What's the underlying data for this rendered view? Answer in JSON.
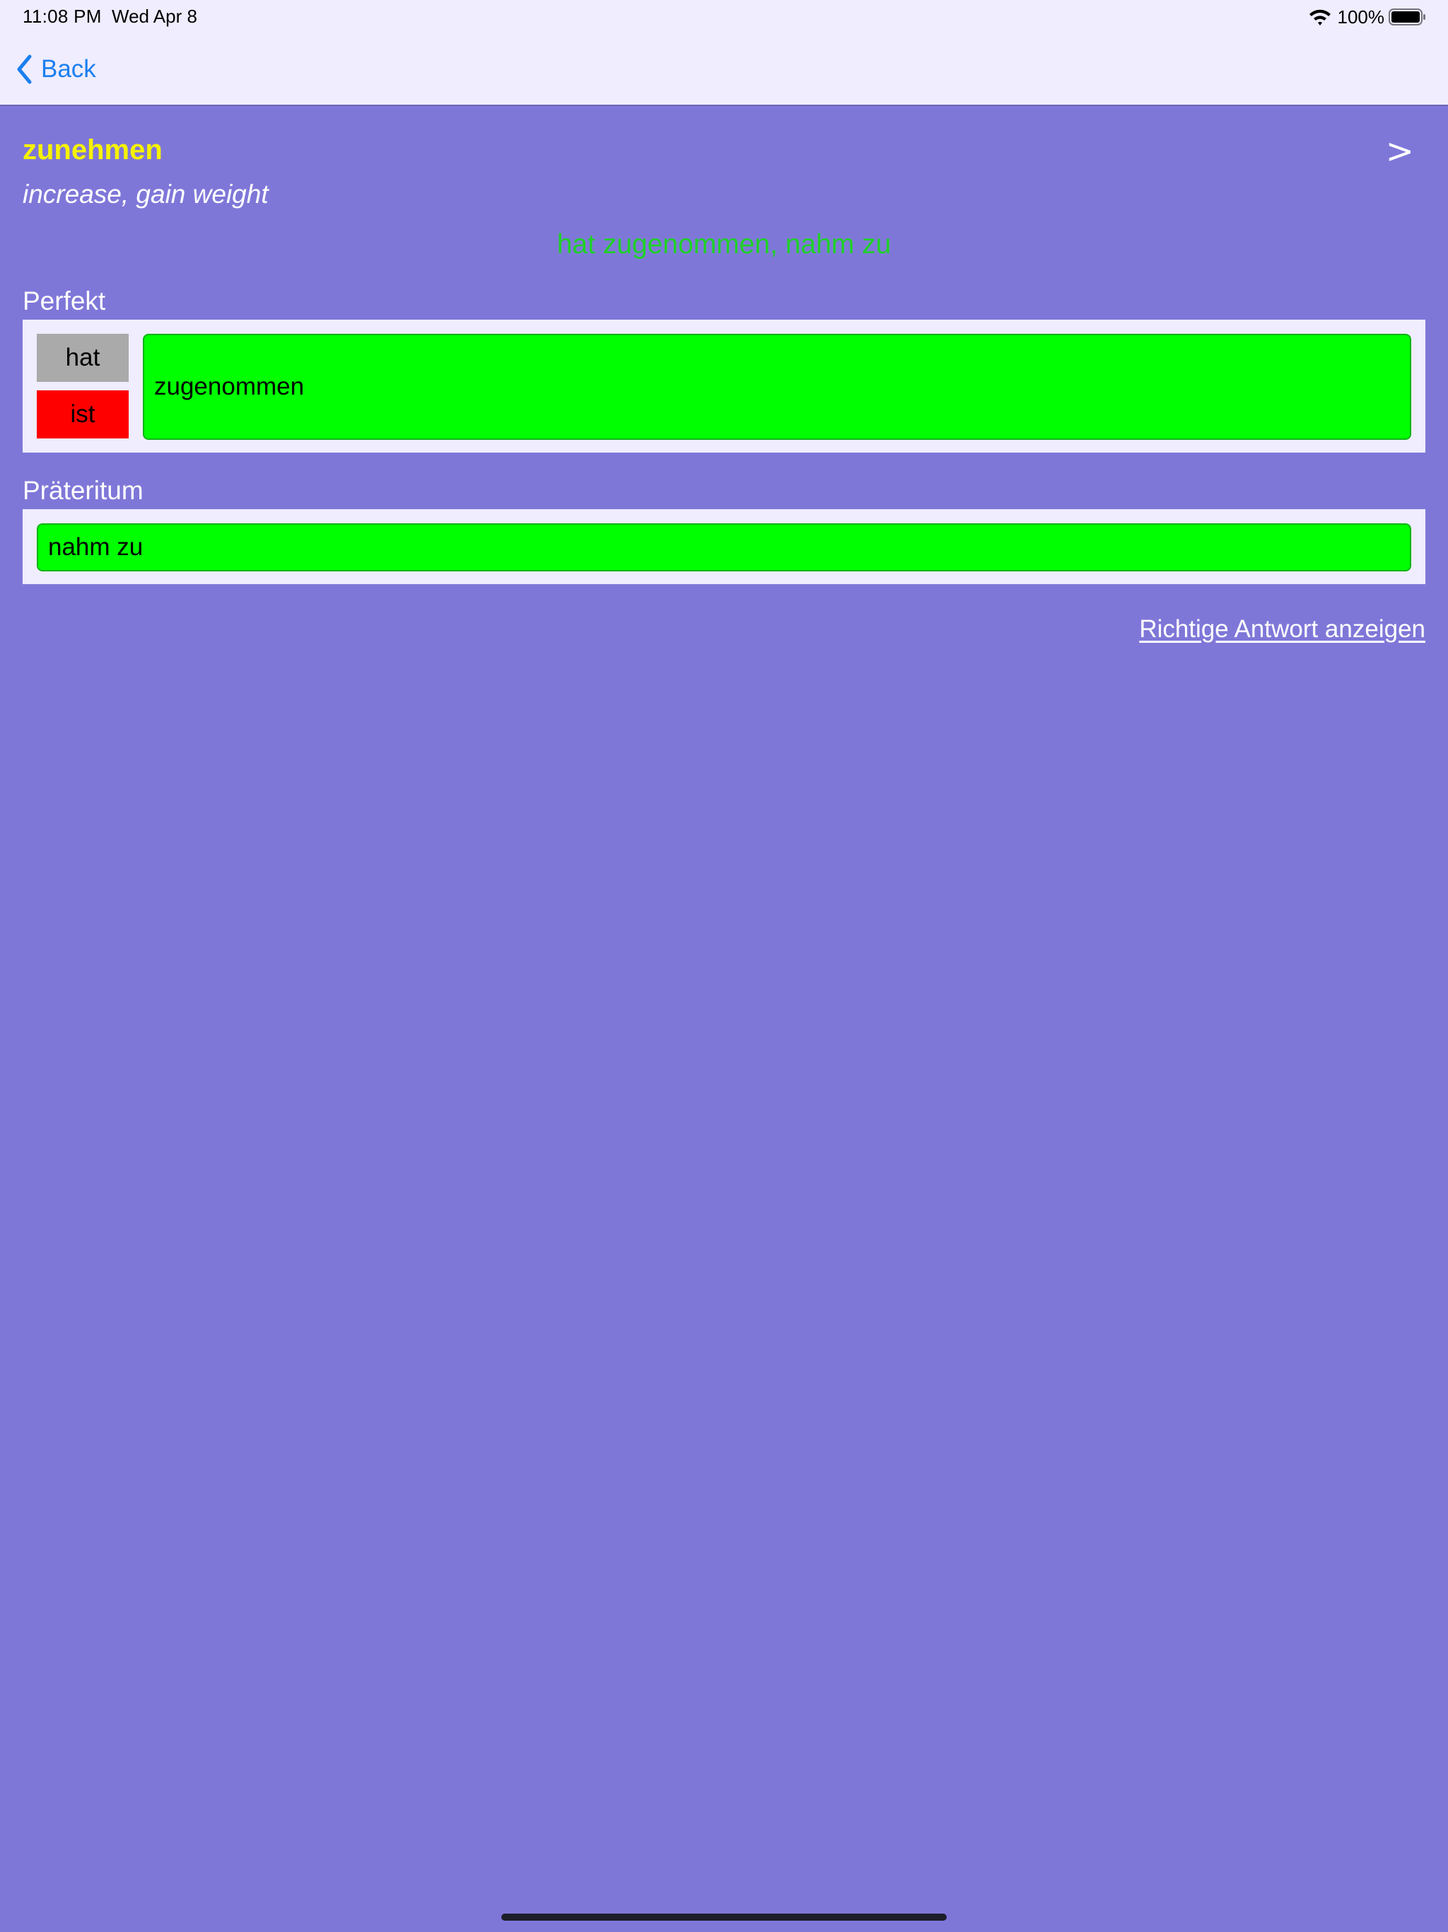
{
  "status_bar": {
    "time": "11:08 PM",
    "date": "Wed Apr 8",
    "battery_percent": "100%",
    "battery_level": 1.0,
    "icons": [
      "wifi-icon",
      "battery-icon"
    ]
  },
  "nav": {
    "back_label": "Back",
    "back_icon": "chevron-left-icon"
  },
  "card": {
    "word": "zunehmen",
    "translation": "increase, gain weight",
    "next_label": ">",
    "answer": "hat zugenommen, nahm zu"
  },
  "perfekt": {
    "label": "Perfekt",
    "aux_options": [
      "hat",
      "ist"
    ],
    "participle_value": "zugenommen"
  },
  "praeteritum": {
    "label": "Präteritum",
    "value": "nahm zu"
  },
  "show_answer_label": "Richtige Antwort anzeigen",
  "colors": {
    "background": "#7f77d8",
    "bar_background": "#efedfe",
    "word": "#f5f200",
    "answer": "#1fd128",
    "correct_field": "#00ff00",
    "aux_hat": "#aaaaaa",
    "aux_ist": "#ff0000",
    "link": "#1a7ff0"
  }
}
